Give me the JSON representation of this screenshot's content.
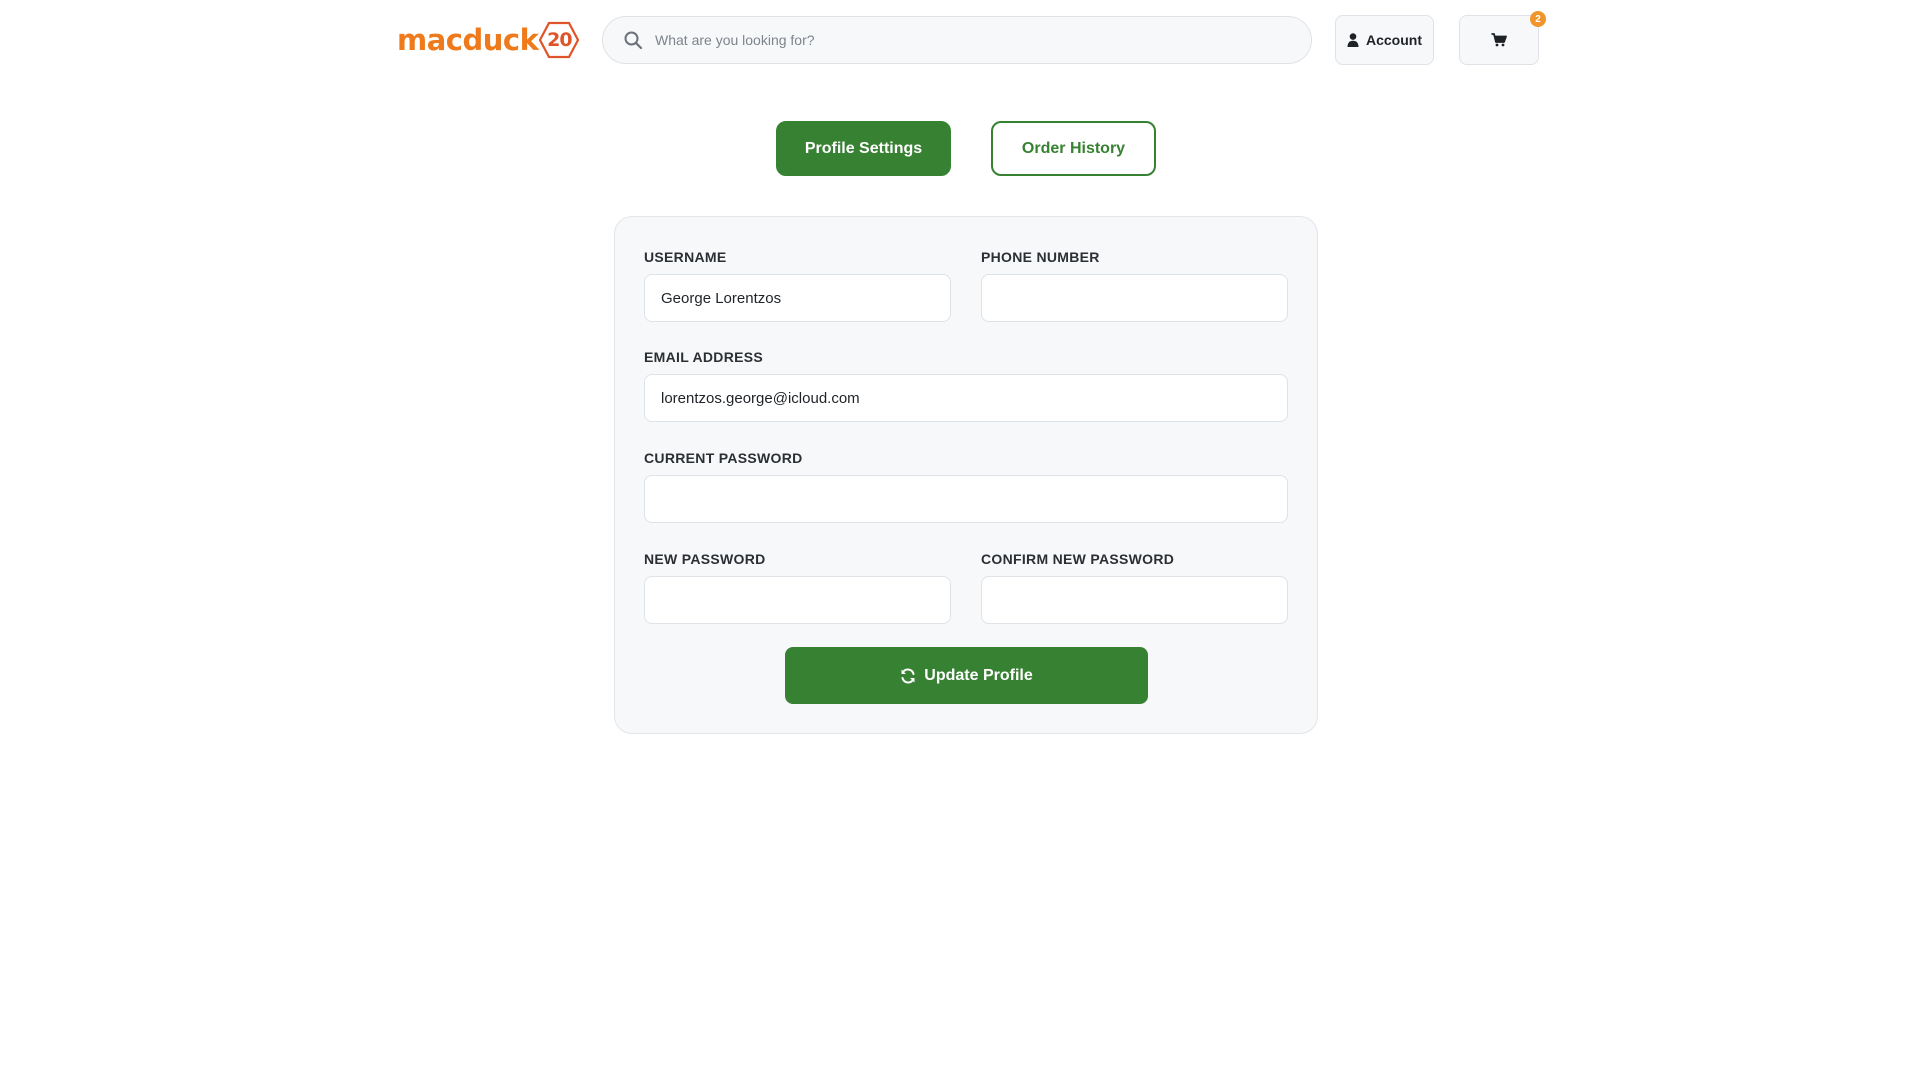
{
  "brand": {
    "logo_text": "macduck",
    "logo_badge": "20"
  },
  "search": {
    "placeholder": "What are you looking for?"
  },
  "header": {
    "account_label": "Account",
    "cart_count": "2"
  },
  "tabs": [
    {
      "label": "Profile Settings",
      "active": true
    },
    {
      "label": "Order History",
      "active": false
    }
  ],
  "form": {
    "username": {
      "label": "USERNAME",
      "value": "George Lorentzos"
    },
    "phone": {
      "label": "PHONE NUMBER",
      "value": ""
    },
    "email": {
      "label": "EMAIL ADDRESS",
      "value": "lorentzos.george@icloud.com"
    },
    "current_password": {
      "label": "CURRENT PASSWORD",
      "value": ""
    },
    "new_password": {
      "label": "NEW PASSWORD",
      "value": ""
    },
    "confirm_password": {
      "label": "CONFIRM NEW PASSWORD",
      "value": ""
    },
    "submit_label": "Update Profile"
  },
  "colors": {
    "brand_orange": "#ee7a1c",
    "badge_red": "#e0542a",
    "primary_green": "#378232",
    "cart_badge": "#f0952c"
  },
  "icons": {
    "search": "search-icon",
    "account": "user-icon",
    "cart": "cart-icon",
    "update": "refresh-icon"
  }
}
